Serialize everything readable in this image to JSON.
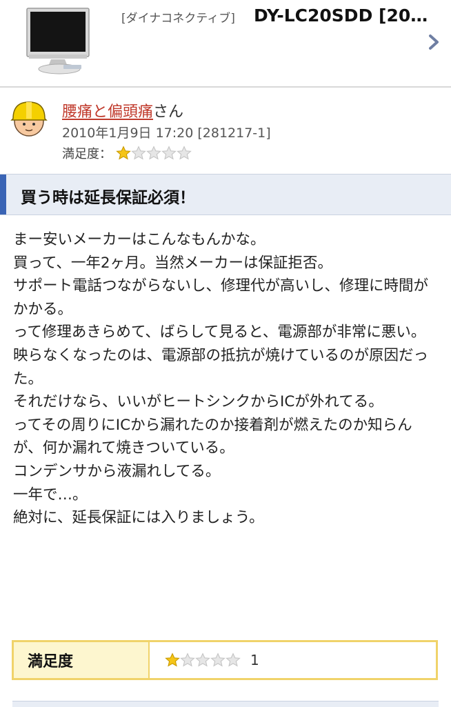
{
  "product": {
    "maker": "[ダイナコネクティブ]",
    "name": "DY-LC20SDD [20…"
  },
  "reviewer": {
    "name": "腰痛と偏頭痛",
    "suffix": "さん",
    "date": "2010年1月9日 17:20 [281217-1]",
    "satisfaction_label": "満足度：",
    "rating": 1,
    "max_rating": 5
  },
  "review": {
    "title": "買う時は延長保証必須！",
    "body": "まー安いメーカーはこんなもんかな。\n買って、一年2ヶ月。当然メーカーは保証拒否。\nサポート電話つながらないし、修理代が高いし、修理に時間がかかる。\nって修理あきらめて、ばらして見ると、電源部が非常に悪い。\n映らなくなったのは、電源部の抵抗が焼けているのが原因だった。\nそれだけなら、いいがヒートシンクからICが外れてる。\nってその周りにICから漏れたのか接着剤が燃えたのか知らんが、何か漏れて焼きついている。\nコンデンサから液漏れしてる。\n一年で…。\n絶対に、延長保証には入りましょう。"
  },
  "score_table": {
    "label": "満足度",
    "value": "1"
  },
  "colors": {
    "accent": "#3a64b5",
    "link": "#c0392b",
    "star_filled": "#f5c518",
    "table_border": "#f0d36a"
  }
}
